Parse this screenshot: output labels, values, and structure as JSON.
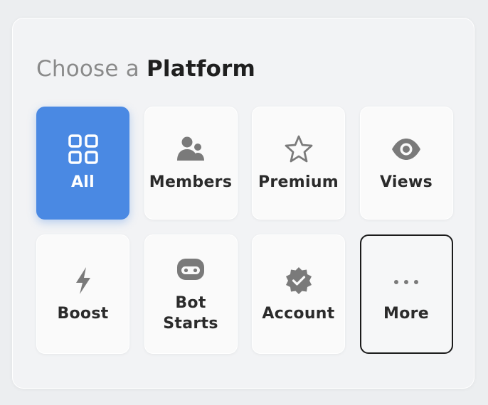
{
  "heading": {
    "prefix": "Choose a",
    "strong": "Platform"
  },
  "tiles": [
    {
      "label": "All",
      "icon": "grid-icon",
      "selected": true
    },
    {
      "label": "Members",
      "icon": "users-icon",
      "selected": false
    },
    {
      "label": "Premium",
      "icon": "star-icon",
      "selected": false
    },
    {
      "label": "Views",
      "icon": "eye-icon",
      "selected": false
    },
    {
      "label": "Boost",
      "icon": "lightning-icon",
      "selected": false
    },
    {
      "label": "Bot\nStarts",
      "icon": "robot-icon",
      "selected": false
    },
    {
      "label": "Account",
      "icon": "verified-badge-icon",
      "selected": false
    },
    {
      "label": "More",
      "icon": "more-dots-icon",
      "selected": false
    }
  ],
  "colors": {
    "accent": "#4a89e3",
    "icon": "#7a7a7a",
    "text": "#2b2b2b",
    "heading_muted": "#8a8a8a"
  }
}
